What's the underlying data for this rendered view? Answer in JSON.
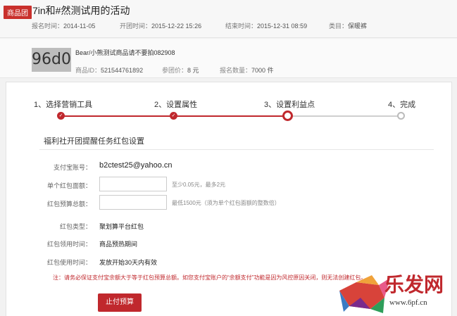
{
  "header": {
    "badge": "商品团",
    "title": "7in和#然测试用的活动",
    "meta": [
      {
        "label": "报名时间：",
        "value": "2014-11-05"
      },
      {
        "label": "开团时间：",
        "value": "2015-12-22 15:26"
      },
      {
        "label": "结束时间：",
        "value": "2015-12-31 08:59"
      },
      {
        "label": "类目：",
        "value": "保暖裤"
      }
    ]
  },
  "product": {
    "thumb_text": "96d0",
    "name": "Bear/小熊测试商品请不要拍082908",
    "meta": [
      {
        "label": "商品ID：",
        "value": "521544761892"
      },
      {
        "label": "参团价：",
        "value": "8 元"
      },
      {
        "label": "报名数量：",
        "value": "7000 件"
      }
    ]
  },
  "steps": [
    {
      "label": "1、选择营销工具",
      "state": "done"
    },
    {
      "label": "2、设置属性",
      "state": "done"
    },
    {
      "label": "3、设置利益点",
      "state": "current"
    },
    {
      "label": "4、完成",
      "state": "todo"
    }
  ],
  "section": {
    "title": "福利社开团提醒任务红包设置",
    "account_label": "支付宝账号：",
    "account_value": "b2ctest25@yahoo.cn",
    "single_label": "单个红包面额：",
    "single_value": "",
    "single_hint": "至少0.05元，最多2元",
    "budget_label": "红包预算总额：",
    "budget_value": "",
    "budget_hint": "最低1500元（须为单个红包面额的整数倍）",
    "type_label": "红包类型：",
    "type_value": "聚划算平台红包",
    "claim_label": "红包领用时间：",
    "claim_value": "商品预热期间",
    "use_label": "红包使用时间：",
    "use_value": "发放开始30天内有效",
    "warning": "注：请务必保证支付宝余额大于等于红包预算总额。如您支付宝账户的“余额支付”功能是因为风控原因关闭，则无法创建红包。",
    "submit": "止付预算"
  },
  "watermark": {
    "text": "乐发网",
    "url": "www.6pf.cn"
  },
  "colors": {
    "accent": "#c0282d",
    "inactive": "#cfcfcf"
  },
  "icons": {
    "step_done": "check-icon"
  }
}
